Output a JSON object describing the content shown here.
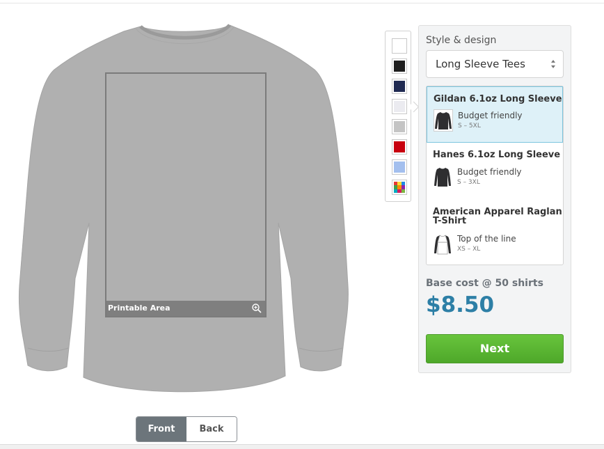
{
  "designer": {
    "printable_area_label": "Printable Area",
    "zoom_icon": "zoom-in-icon"
  },
  "view_toggle": {
    "front_label": "Front",
    "back_label": "Back",
    "active": "front"
  },
  "shirt": {
    "color": "#b0b0b0"
  },
  "swatches": [
    {
      "name": "white",
      "color": "#ffffff"
    },
    {
      "name": "black",
      "color": "#1f1f1f"
    },
    {
      "name": "navy",
      "color": "#202a52"
    },
    {
      "name": "light-gray-selected",
      "color": "#ebebf0"
    },
    {
      "name": "heather-gray",
      "color": "#c4c4c4"
    },
    {
      "name": "red",
      "color": "#c8000f"
    },
    {
      "name": "light-blue",
      "color": "#a3bfee"
    },
    {
      "name": "more-colors",
      "color": "multi"
    }
  ],
  "style_panel": {
    "label": "Style & design",
    "selected_style": "Long Sleeve Tees",
    "products": [
      {
        "name": "Gildan 6.1oz Long Sleeve",
        "tag": "Budget friendly",
        "sizes": "S – 5XL",
        "selected": true
      },
      {
        "name": "Hanes 6.1oz Long Sleeve",
        "tag": "Budget friendly",
        "sizes": "S – 3XL",
        "selected": false
      },
      {
        "name": "American Apparel Raglan T-Shirt",
        "tag": "Top of the line",
        "sizes": "XS – XL",
        "selected": false
      }
    ],
    "cost_label": "Base cost @ 50 shirts",
    "cost_value": "$8.50",
    "next_label": "Next"
  },
  "colors": {
    "accent_blue": "#2d7fa6",
    "next_green": "#5cb832",
    "selected_bg": "#def1f8"
  }
}
